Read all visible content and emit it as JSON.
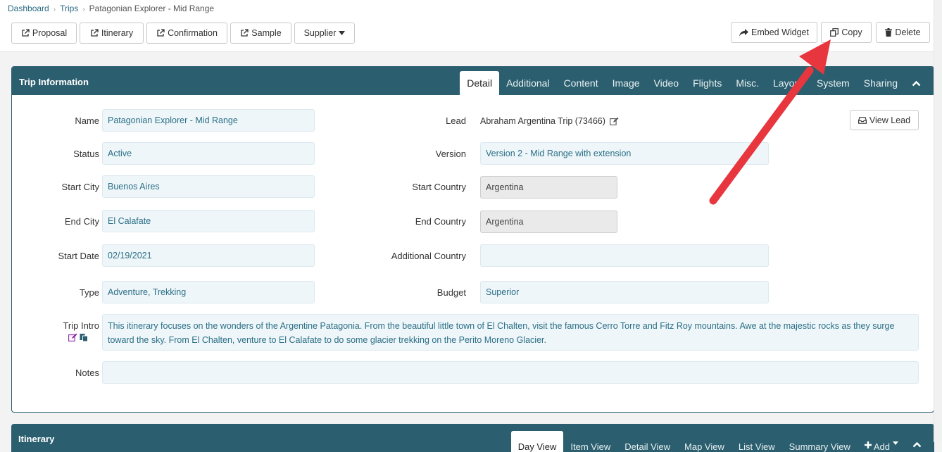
{
  "breadcrumb": [
    "Dashboard",
    "Trips",
    "Patagonian Explorer - Mid Range"
  ],
  "toolbar": {
    "proposal": "Proposal",
    "itinerary": "Itinerary",
    "confirmation": "Confirmation",
    "sample": "Sample",
    "supplier": "Supplier",
    "embed": "Embed Widget",
    "copy": "Copy",
    "delete": "Delete"
  },
  "trip_panel": {
    "title": "Trip Information",
    "tabs": [
      "Detail",
      "Additional",
      "Content",
      "Image",
      "Video",
      "Flights",
      "Misc.",
      "Layout",
      "System",
      "Sharing"
    ],
    "active_tab": "Detail"
  },
  "form": {
    "name_label": "Name",
    "name_value": "Patagonian Explorer - Mid Range",
    "status_label": "Status",
    "status_value": "Active",
    "start_city_label": "Start City",
    "start_city_value": "Buenos Aires",
    "end_city_label": "End City",
    "end_city_value": "El Calafate",
    "start_date_label": "Start Date",
    "start_date_value": "02/19/2021",
    "type_label": "Type",
    "type_value": "Adventure, Trekking",
    "lead_label": "Lead",
    "lead_value": "Abraham Argentina Trip (73466)",
    "view_lead": "View Lead",
    "version_label": "Version",
    "version_value": "Version 2 - Mid Range with extension",
    "start_country_label": "Start Country",
    "start_country_value": "Argentina",
    "end_country_label": "End Country",
    "end_country_value": "Argentina",
    "additional_country_label": "Additional Country",
    "additional_country_value": "",
    "budget_label": "Budget",
    "budget_value": "Superior",
    "trip_intro_label": "Trip Intro",
    "trip_intro_value": "This itinerary focuses on the wonders of the Argentine Patagonia. From the beautiful little town of El Chalten, visit the famous Cerro Torre and Fitz Roy mountains. Awe at the majestic rocks as they surge toward the sky. From El Chalten, venture to El Calafate to do some glacier trekking on the Perito Moreno Glacier.",
    "notes_label": "Notes",
    "notes_value": ""
  },
  "itinerary_panel": {
    "title": "Itinerary",
    "tabs": [
      "Day View",
      "Item View",
      "Detail View",
      "Map View",
      "List View",
      "Summary View"
    ],
    "add": "Add",
    "active_tab": "Day View"
  },
  "icons": [
    "external-link-icon",
    "caret-down-icon",
    "share-icon",
    "copy-icon",
    "trash-icon",
    "chevron-up-icon",
    "edit-icon",
    "inbox-icon",
    "paste-icon",
    "plus-icon"
  ],
  "colors": {
    "panel_header": "#2b5f6f",
    "field_bg": "#eef6fa",
    "field_text": "#2c6f85",
    "arrow": "#e8363f"
  }
}
